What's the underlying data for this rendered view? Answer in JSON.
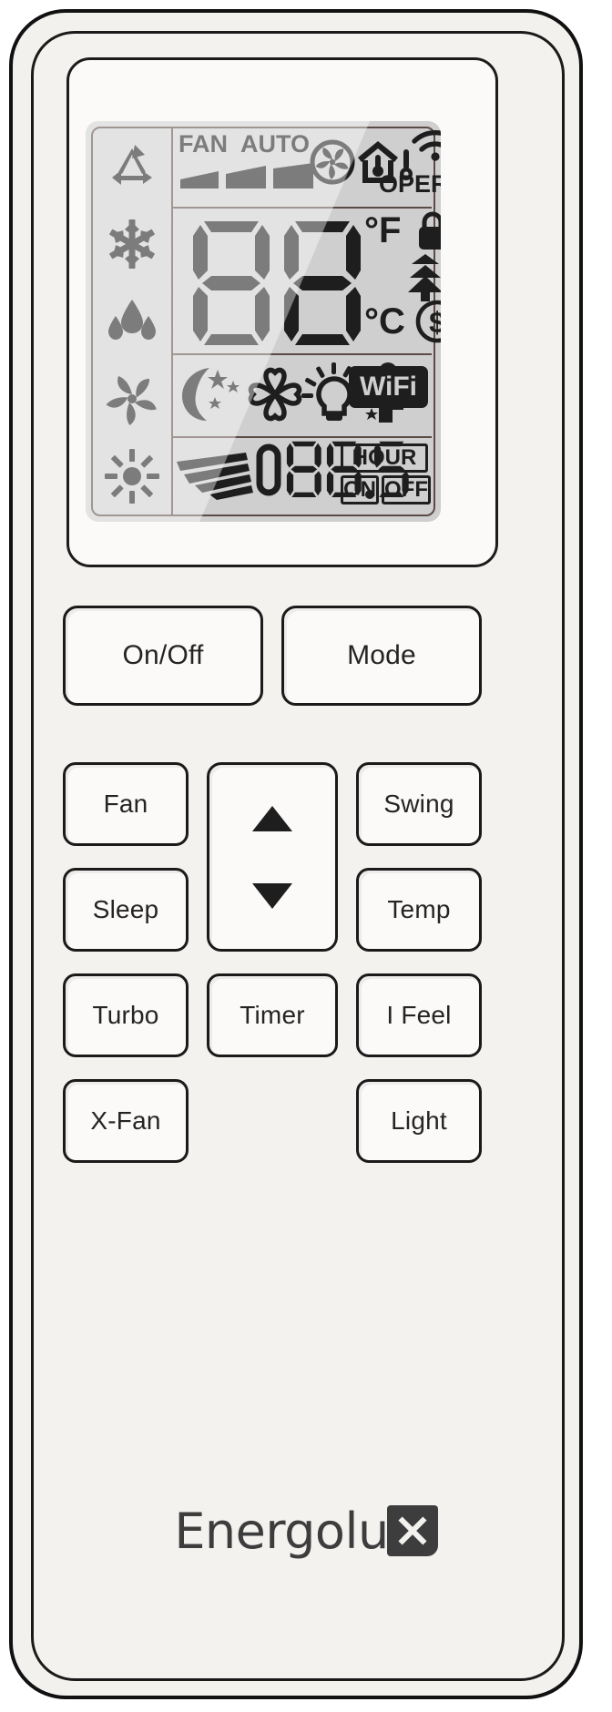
{
  "device": {
    "brand": "Energolu",
    "brand_mark": "x",
    "type": "air-conditioner-remote-control"
  },
  "colors": {
    "case": "#f3f2ef",
    "case_outline": "#111111",
    "lcd_background": "#cfcfcf",
    "lcd_segment": "#1e1e1e",
    "lcd_frame": "#5b4b46",
    "button_face": "#fbfaf8",
    "button_outline": "#1a1a1a",
    "label_text": "#242424",
    "logo_text": "#3d3d3d"
  },
  "lcd": {
    "mode_column": [
      {
        "name": "auto-mode-icon",
        "label": "AUTO"
      },
      {
        "name": "cool-mode-snowflake-icon",
        "label": "COOL"
      },
      {
        "name": "dry-mode-droplets-icon",
        "label": "DRY"
      },
      {
        "name": "fan-mode-pinwheel-icon",
        "label": "FAN"
      },
      {
        "name": "heat-mode-sun-icon",
        "label": "HEAT"
      }
    ],
    "top_row": {
      "fan_label": "FAN",
      "auto_label": "AUTO",
      "fan_speed_bars": 3,
      "icons": [
        {
          "name": "fan-blower-icon",
          "label": "Fan blower"
        },
        {
          "name": "indoor-temperature-house-icon",
          "label": "Indoor temp"
        },
        {
          "name": "outdoor-thermometer-icon",
          "label": "Outdoor temp"
        },
        {
          "name": "wifi-signal-icon",
          "label": "Wi-Fi signal"
        }
      ],
      "oper_label": "OPER"
    },
    "temperature": {
      "digits": "88",
      "unit_fahrenheit": "°F",
      "unit_celsius": "°C",
      "indicators": [
        {
          "name": "lock-icon",
          "label": "Child lock"
        },
        {
          "name": "tree-air-icon",
          "label": "Health / fresh air"
        },
        {
          "name": "house-return-icon",
          "label": "Air circulation"
        },
        {
          "name": "energy-saving-dollar-icon",
          "label": "Energy saving"
        }
      ]
    },
    "feature_row": [
      {
        "name": "sleep-moon-stars-icon",
        "label": "Sleep"
      },
      {
        "name": "x-fan-clover-icon",
        "label": "X-Fan"
      },
      {
        "name": "light-bulb-icon",
        "label": "Light"
      },
      {
        "name": "i-feel-person-icon",
        "label": "I Feel"
      },
      {
        "name": "wifi-badge",
        "label": "WiFi"
      }
    ],
    "timer_row": {
      "swing-icon": "swing-louver-icon",
      "digit_lead": "0",
      "digits": "88.5",
      "hour_label": "HOUR",
      "on_label": "ON",
      "off_label": "OFF"
    }
  },
  "buttons": [
    {
      "name": "on-off-button",
      "label": "On/Off"
    },
    {
      "name": "mode-button",
      "label": "Mode"
    },
    {
      "name": "fan-button",
      "label": "Fan"
    },
    {
      "name": "swing-button",
      "label": "Swing"
    },
    {
      "name": "sleep-button",
      "label": "Sleep"
    },
    {
      "name": "temp-button",
      "label": "Temp"
    },
    {
      "name": "turbo-button",
      "label": "Turbo"
    },
    {
      "name": "timer-button",
      "label": "Timer"
    },
    {
      "name": "i-feel-button",
      "label": "I Feel"
    },
    {
      "name": "x-fan-button",
      "label": "X-Fan"
    },
    {
      "name": "light-button",
      "label": "Light"
    },
    {
      "name": "up-button",
      "label": "▲"
    },
    {
      "name": "down-button",
      "label": "▼"
    }
  ]
}
